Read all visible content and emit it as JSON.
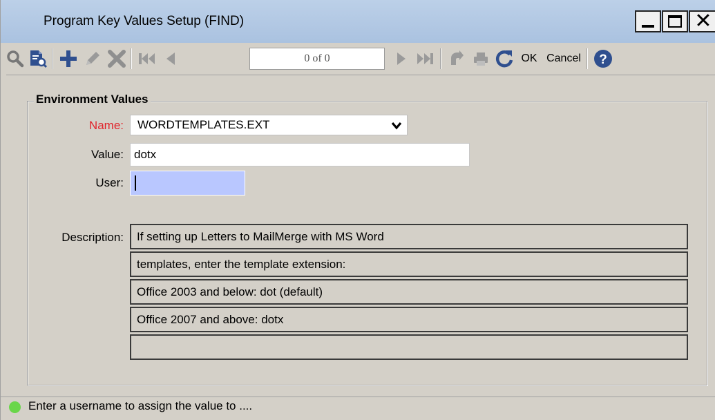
{
  "window": {
    "title": "Program Key Values Setup (FIND)"
  },
  "toolbar": {
    "record_position": "0 of 0",
    "ok_label": "OK",
    "cancel_label": "Cancel"
  },
  "form": {
    "group_title": "Environment Values",
    "name_label": "Name:",
    "name_value": "WORDTEMPLATES.EXT",
    "value_label": "Value:",
    "value_value": "dotx",
    "user_label": "User:",
    "user_value": "",
    "description_label": "Description:",
    "description_lines": [
      "If setting up Letters to MailMerge with MS Word",
      "templates, enter the template extension:",
      "Office 2003 and below: dot  (default)",
      "Office 2007 and above: dotx",
      ""
    ]
  },
  "status": {
    "message": "Enter a username to assign the value to ...."
  },
  "colors": {
    "required_label": "#e0242b",
    "user_field_bg": "#b9c7ff",
    "status_ok": "#6ad64a",
    "icon_blue": "#2f4f8f"
  }
}
